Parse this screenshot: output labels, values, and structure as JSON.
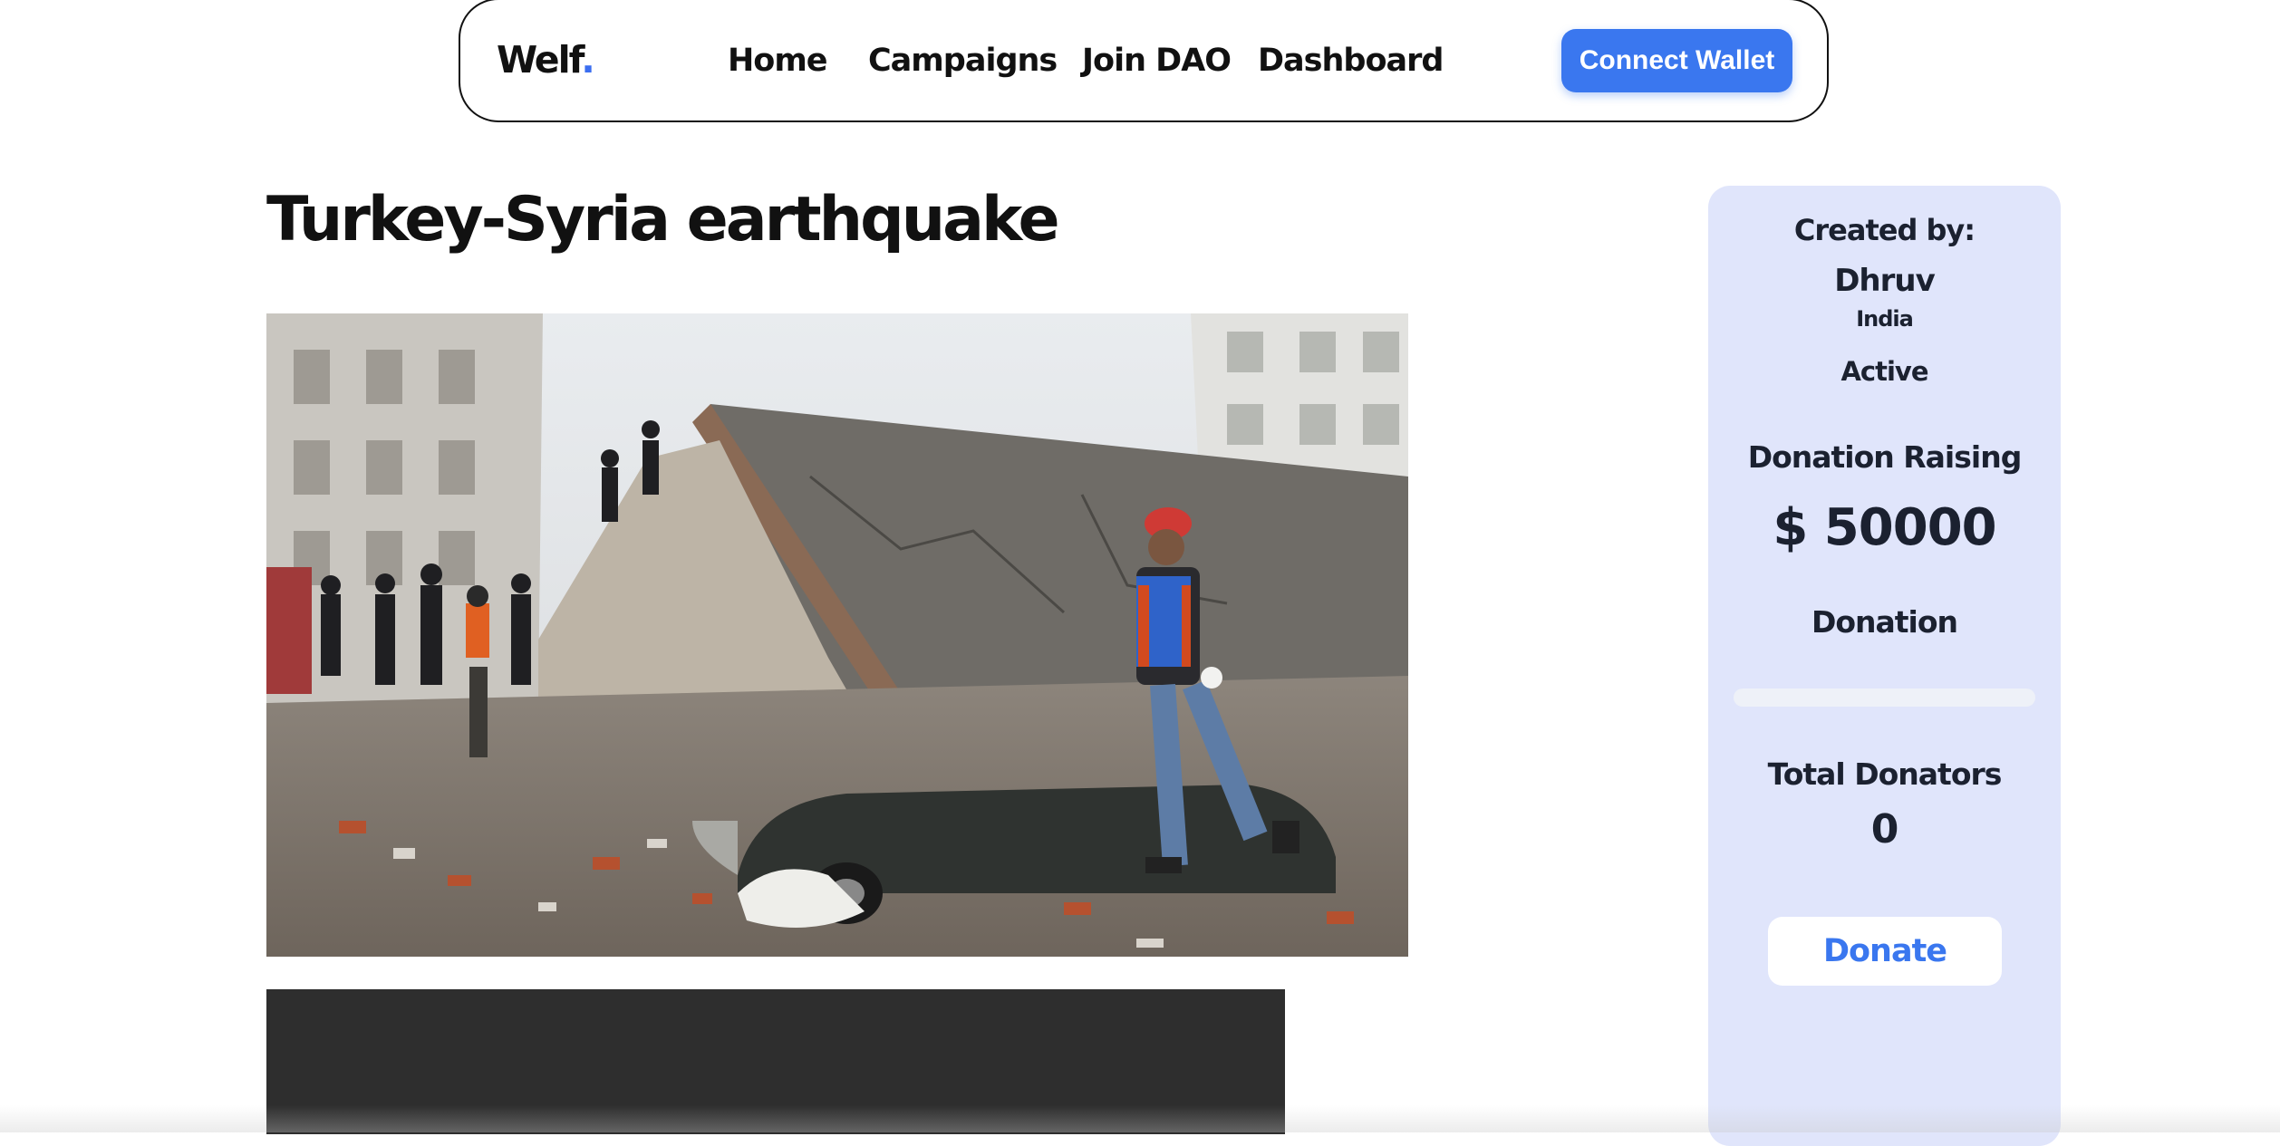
{
  "nav": {
    "logo_text": "Welf",
    "logo_dot": ".",
    "links": [
      "Home",
      "Campaigns",
      "Join DAO",
      "Dashboard"
    ],
    "wallet_button": "Connect Wallet",
    "accent_color": "#3a77ef"
  },
  "campaign": {
    "title": "Turkey-Syria earthquake",
    "image_alt_icon": "earthquake-rubble-photo"
  },
  "sidebar": {
    "created_by_label": "Created by:",
    "creator_name": "Dhruv",
    "creator_country": "India",
    "status": "Active",
    "raising_label": "Donation Raising",
    "raising_amount": "$ 50000",
    "donation_label": "Donation",
    "donation_progress": 0,
    "total_donators_label": "Total Donators",
    "total_donators": "0",
    "donate_button": "Donate"
  }
}
